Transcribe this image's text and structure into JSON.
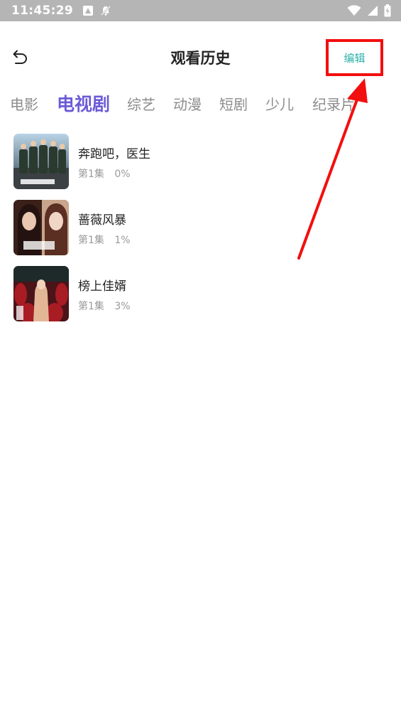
{
  "status_bar": {
    "time": "11:45:29",
    "icons": [
      "a-notification-icon",
      "notification-off-icon",
      "wifi-icon",
      "signal-icon",
      "battery-charging-icon"
    ]
  },
  "header": {
    "title": "观看历史",
    "edit_label": "编辑",
    "back_icon": "back-arrow-icon"
  },
  "tabs": [
    {
      "label": "电影",
      "active": false
    },
    {
      "label": "电视剧",
      "active": true
    },
    {
      "label": "综艺",
      "active": false
    },
    {
      "label": "动漫",
      "active": false
    },
    {
      "label": "短剧",
      "active": false
    },
    {
      "label": "少儿",
      "active": false
    },
    {
      "label": "纪录片",
      "active": false
    }
  ],
  "history": [
    {
      "title": "奔跑吧，医生",
      "episode": "第1集",
      "progress": "0%"
    },
    {
      "title": "蔷薇风暴",
      "episode": "第1集",
      "progress": "1%"
    },
    {
      "title": "榜上佳婿",
      "episode": "第1集",
      "progress": "3%"
    }
  ],
  "colors": {
    "accent_tab": "#6b5bd6",
    "edit_text": "#2db2a8",
    "highlight_box": "#f20f0f",
    "status_bar": "#b5b5b5"
  }
}
